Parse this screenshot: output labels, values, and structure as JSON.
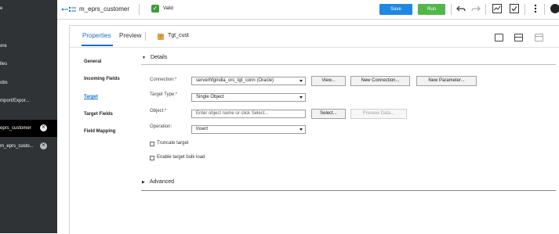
{
  "sidebar": {
    "items": [
      {
        "label": "e"
      },
      {
        "label": "ore"
      },
      {
        "label": "lles"
      },
      {
        "label": "obs"
      },
      {
        "label": "mport/Expor..."
      }
    ],
    "open_tabs": [
      {
        "label": "eprs_customer",
        "state": "active"
      },
      {
        "label": "m_eprs_custo...",
        "state": "inactive"
      }
    ]
  },
  "topbar": {
    "mapping_name": "m_eprs_customer",
    "valid_label": "Valid",
    "save_label": "Save",
    "run_label": "Run",
    "colors": {
      "save": "#1e88e5",
      "run": "#50b848",
      "valid": "#3a9d3a"
    }
  },
  "panel": {
    "tabs": {
      "properties": "Properties",
      "preview": "Preview"
    },
    "target_name": "Tgt_cust",
    "nav": {
      "general": "General",
      "incoming_fields": "Incoming Fields",
      "target": "Target",
      "target_fields": "Target Fields",
      "field_mapping": "Field Mapping"
    },
    "details": {
      "title": "Details",
      "connection_label": "Connection:",
      "connection_value": "serverhfgindia_orc_tgt_conn (Oracle)",
      "view_button": "View...",
      "new_connection_button": "New Connection...",
      "new_parameter_button": "New Parameter...",
      "target_type_label": "Target Type:",
      "target_type_value": "Single Object",
      "object_label": "Object:",
      "object_placeholder": "Enter object name or click Select...",
      "select_button": "Select...",
      "preview_data_button": "Preview Data...",
      "operation_label": "Operation:",
      "operation_value": "Insert",
      "truncate_label": "Truncate target",
      "bulk_load_label": "Enable target bulk load",
      "required_marker": "*"
    },
    "advanced": {
      "title": "Advanced"
    }
  }
}
